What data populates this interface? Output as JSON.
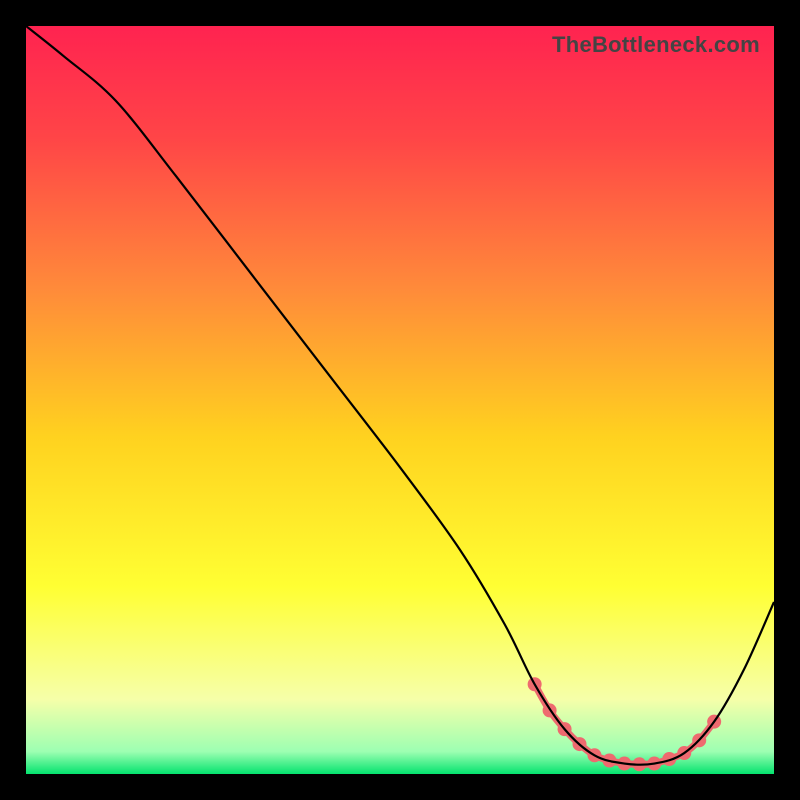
{
  "watermark": "TheBottleneck.com",
  "chart_data": {
    "type": "line",
    "title": "",
    "xlabel": "",
    "ylabel": "",
    "xlim": [
      0,
      100
    ],
    "ylim": [
      0,
      100
    ],
    "gradient_stops": [
      {
        "offset": 0.0,
        "color": "#ff2350"
      },
      {
        "offset": 0.15,
        "color": "#ff4547"
      },
      {
        "offset": 0.35,
        "color": "#ff8a3a"
      },
      {
        "offset": 0.55,
        "color": "#ffd21f"
      },
      {
        "offset": 0.75,
        "color": "#ffff33"
      },
      {
        "offset": 0.9,
        "color": "#f6ffa9"
      },
      {
        "offset": 0.97,
        "color": "#9dffb2"
      },
      {
        "offset": 1.0,
        "color": "#04e36e"
      }
    ],
    "series": [
      {
        "name": "bottleneck-curve",
        "color": "#000000",
        "width": 2.2,
        "x": [
          0,
          5,
          12,
          20,
          30,
          40,
          50,
          58,
          64,
          68,
          72,
          76,
          80,
          84,
          88,
          92,
          96,
          100
        ],
        "y": [
          100,
          96,
          90,
          80,
          67,
          54,
          41,
          30,
          20,
          12,
          6,
          2.5,
          1.4,
          1.4,
          2.8,
          7,
          14,
          23
        ]
      }
    ],
    "highlight": {
      "name": "sweet-spot",
      "color": "#ee6a6f",
      "marker_size": 7,
      "line_width": 7,
      "x": [
        68,
        70,
        72,
        74,
        76,
        78,
        80,
        82,
        84,
        86,
        88,
        90,
        92
      ],
      "y": [
        12,
        8.5,
        6,
        4,
        2.5,
        1.8,
        1.4,
        1.3,
        1.4,
        2.0,
        2.8,
        4.5,
        7
      ]
    }
  }
}
